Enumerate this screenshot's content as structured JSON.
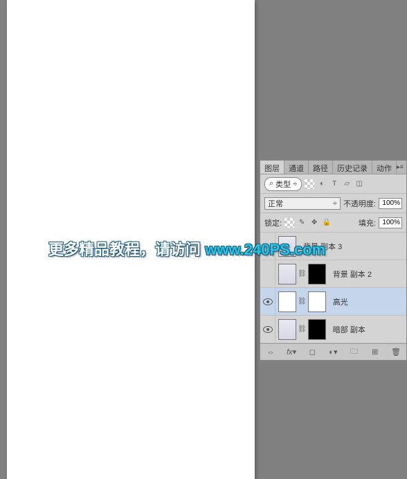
{
  "watermark": {
    "text": "更多精品教程，请访问 ",
    "url": "www.240PS.com"
  },
  "panel": {
    "tabs": [
      "图层",
      "通道",
      "路径",
      "历史记录",
      "动作"
    ],
    "filter_label": "类型",
    "blend_mode": "正常",
    "opacity_label": "不透明度:",
    "opacity_value": "100%",
    "lock_label": "锁定:",
    "fill_label": "填充:",
    "fill_value": "100%",
    "layers": [
      {
        "name": "背景 副本 3",
        "visible": false,
        "selected": false,
        "mask": false,
        "thumb": "phone"
      },
      {
        "name": "背景 副本 2",
        "visible": false,
        "selected": false,
        "mask": true,
        "thumb": "phone",
        "mask_style": "dark"
      },
      {
        "name": "高光",
        "visible": true,
        "selected": true,
        "mask": true,
        "thumb": "white",
        "mask_style": "white"
      },
      {
        "name": "暗部 副本",
        "visible": true,
        "selected": false,
        "mask": true,
        "thumb": "phone",
        "mask_style": "dark"
      }
    ]
  }
}
